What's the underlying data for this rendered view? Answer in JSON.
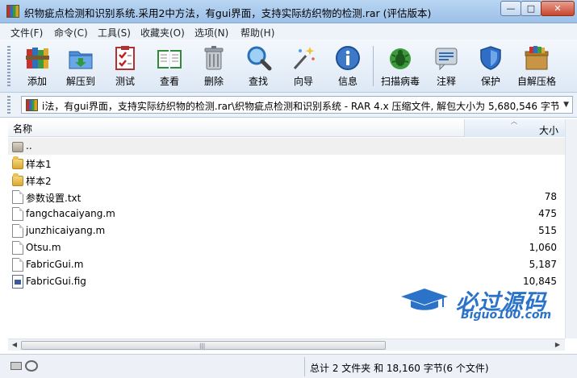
{
  "window": {
    "title": "织物疵点检测和识别系统.采用2中方法，有gui界面，支持实际纺织物的检测.rar (评估版本)",
    "min_label": "—",
    "max_label": "□",
    "close_label": "✕"
  },
  "menu": [
    "文件(F)",
    "命令(C)",
    "工具(S)",
    "收藏夹(O)",
    "选项(N)",
    "帮助(H)"
  ],
  "toolbar": {
    "add": "添加",
    "extract": "解压到",
    "test": "测试",
    "view": "查看",
    "delete": "删除",
    "find": "查找",
    "wizard": "向导",
    "info": "信息",
    "scan": "扫描病毒",
    "comment": "注释",
    "protect": "保护",
    "sfx": "自解压格"
  },
  "address": {
    "text": "i法，有gui界面，支持实际纺织物的检测.rar\\织物疵点检测和识别系统 - RAR 4.x 压缩文件, 解包大小为 5,680,546 字节"
  },
  "columns": {
    "name": "名称",
    "size": "大小"
  },
  "files": [
    {
      "name": "..",
      "size": ""
    },
    {
      "name": "样本1",
      "size": ""
    },
    {
      "name": "样本2",
      "size": ""
    },
    {
      "name": "参数设置.txt",
      "size": "78"
    },
    {
      "name": "fangchacaiyang.m",
      "size": "475"
    },
    {
      "name": "junzhicaiyang.m",
      "size": "515"
    },
    {
      "name": "Otsu.m",
      "size": "1,060"
    },
    {
      "name": "FabricGui.m",
      "size": "5,187"
    },
    {
      "name": "FabricGui.fig",
      "size": "10,845"
    }
  ],
  "status": {
    "text": "总计 2 文件夹 和 18,160 字节(6 个文件)"
  },
  "watermark": {
    "title": "必过源码",
    "url": "Biguo100.com"
  },
  "icons": {
    "add": "books-icon",
    "extract": "folder-icon",
    "test": "checklist-icon",
    "view": "book-icon",
    "delete": "trash-icon",
    "find": "magnifier-icon",
    "wizard": "wand-icon",
    "info": "info-icon",
    "scan": "bug-icon",
    "comment": "comment-icon",
    "protect": "shield-icon",
    "sfx": "box-icon"
  }
}
